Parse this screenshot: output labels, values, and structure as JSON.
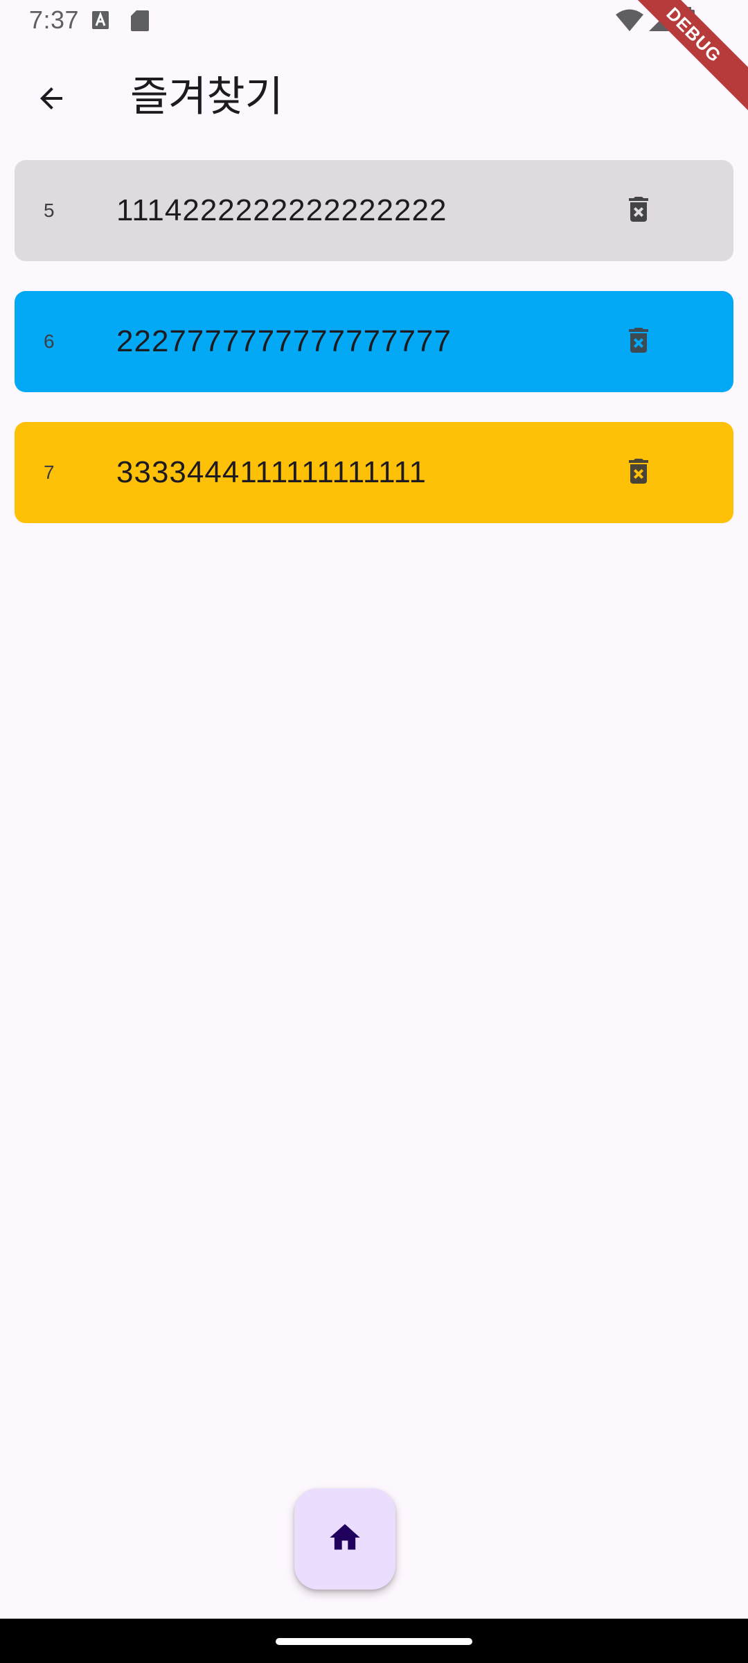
{
  "status_bar": {
    "time": "7:37",
    "icons": [
      "a-notification-icon",
      "sd-card-icon",
      "wifi-icon",
      "signal-icon",
      "battery-icon"
    ]
  },
  "debug_banner": "DEBUG",
  "app_bar": {
    "back_icon": "arrow-back-icon",
    "title": "즐겨찾기"
  },
  "favorites": [
    {
      "id": "5",
      "value": "1114222222222222222",
      "color": "#dedade",
      "delete_icon": "delete-forever-icon"
    },
    {
      "id": "6",
      "value": "2227777777777777777",
      "color": "#03a9f4",
      "delete_icon": "delete-forever-icon"
    },
    {
      "id": "7",
      "value": "3333444111111111111",
      "color": "#ffc107",
      "delete_icon": "delete-forever-icon"
    }
  ],
  "fab": {
    "icon": "home-icon",
    "color": "#eaddfe",
    "icon_color": "#21005d"
  }
}
